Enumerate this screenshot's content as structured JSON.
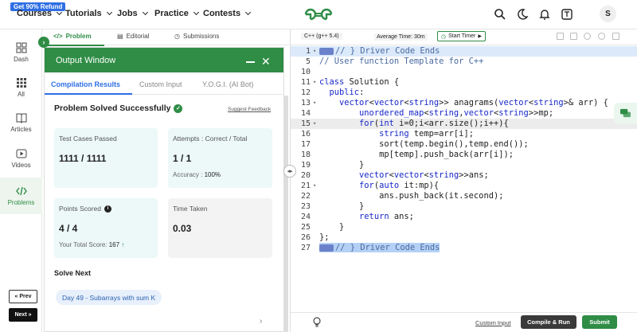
{
  "topnav": {
    "promo": "Get 90% Refund",
    "items": [
      {
        "label": "Courses"
      },
      {
        "label": "Tutorials"
      },
      {
        "label": "Jobs"
      },
      {
        "label": "Practice"
      },
      {
        "label": "Contests"
      }
    ],
    "avatar": "S",
    "brand_color": "#2f8d46"
  },
  "sidebar": {
    "items": [
      {
        "label": "Dash",
        "icon": "dashboard-icon"
      },
      {
        "label": "All",
        "icon": "grid-icon"
      },
      {
        "label": "Articles",
        "icon": "book-icon"
      },
      {
        "label": "Videos",
        "icon": "play-icon"
      },
      {
        "label": "Problems",
        "icon": "code-icon",
        "active": true
      }
    ],
    "prev": "« Prev",
    "next": "Next »"
  },
  "problem_tabs": [
    {
      "label": "Problem",
      "active": true
    },
    {
      "label": "Editorial"
    },
    {
      "label": "Submissions"
    }
  ],
  "output_window": {
    "title": "Output Window",
    "tabs": [
      {
        "label": "Compilation Results",
        "active": true
      },
      {
        "label": "Custom Input"
      },
      {
        "label": "Y.O.G.I. (AI Bot)"
      }
    ],
    "status": "Problem Solved Successfully",
    "suggest_feedback": "Suggest Feedback",
    "cards": {
      "test_cases": {
        "label": "Test Cases Passed",
        "value": "1111 / 1111"
      },
      "attempts": {
        "label": "Attempts : Correct / Total",
        "value": "1 / 1",
        "sub_label": "Accuracy :",
        "sub_value": "100%"
      },
      "points": {
        "label": "Points Scored",
        "value": "4 / 4",
        "sub_label": "Your Total Score:",
        "sub_value": "167"
      },
      "time": {
        "label": "Time Taken",
        "value": "0.03"
      }
    },
    "solve_next": {
      "heading": "Solve Next",
      "item": "Day 49 - Subarrays with sum K"
    }
  },
  "editor": {
    "language": "C++ (g++ 5.4)",
    "avg_time": "Average Time: 30m",
    "start_timer": "Start Timer",
    "lines": [
      {
        "n": "1",
        "text": "// } Driver Code Ends",
        "style": "chipcomment",
        "row": "hl",
        "fold": true
      },
      {
        "n": "5",
        "text": "// User function Template for C++",
        "style": "comment"
      },
      {
        "n": "10",
        "text": ""
      },
      {
        "n": "11",
        "text": "class Solution {",
        "fold": true
      },
      {
        "n": "12",
        "text": "  public:"
      },
      {
        "n": "13",
        "text": "    vector<vector<string>> anagrams(vector<string>& arr) {",
        "fold": true
      },
      {
        "n": "14",
        "text": "        unordered_map<string,vector<string>>mp;"
      },
      {
        "n": "15",
        "text": "        for(int i=0;i<arr.size();i++){",
        "row": "current",
        "fold": true
      },
      {
        "n": "16",
        "text": "            string temp=arr[i];"
      },
      {
        "n": "17",
        "text": "            sort(temp.begin(),temp.end());"
      },
      {
        "n": "18",
        "text": "            mp[temp].push_back(arr[i]);"
      },
      {
        "n": "19",
        "text": "        }"
      },
      {
        "n": "20",
        "text": "        vector<vector<string>>ans;"
      },
      {
        "n": "21",
        "text": "        for(auto it:mp){",
        "fold": true
      },
      {
        "n": "22",
        "text": "            ans.push_back(it.second);"
      },
      {
        "n": "23",
        "text": "        }"
      },
      {
        "n": "24",
        "text": "        return ans;"
      },
      {
        "n": "25",
        "text": "    }"
      },
      {
        "n": "26",
        "text": "};"
      },
      {
        "n": "27",
        "text": "// } Driver Code Ends",
        "style": "chipcomment",
        "row": "sel"
      }
    ],
    "custom_input": "Custom Input",
    "compile_run": "Compile & Run",
    "submit": "Submit"
  }
}
